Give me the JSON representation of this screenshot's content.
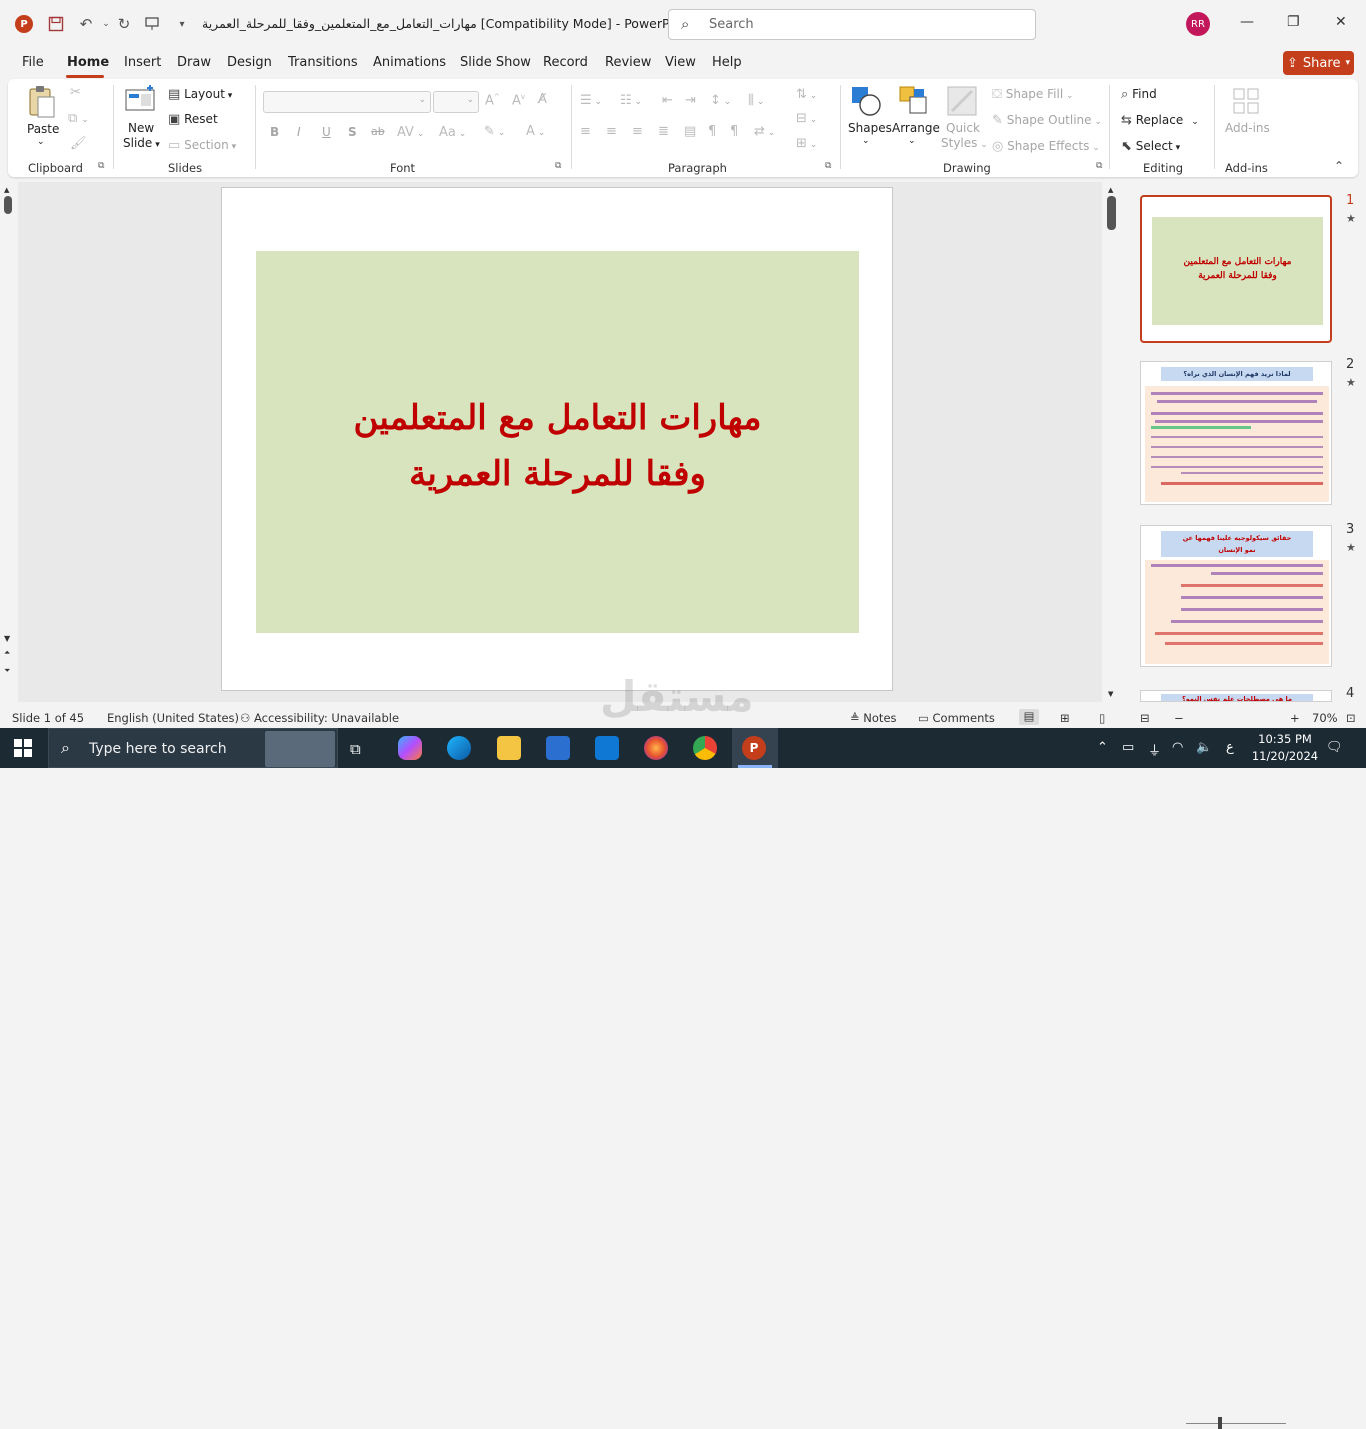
{
  "titlebar": {
    "doc_title": "مهارات_التعامل_مع_المتعلمين_وفقا_للمرحلة_العمرية [Compatibility Mode]  -  PowerP...",
    "search_placeholder": "Search",
    "avatar_initials": "RR"
  },
  "menu": {
    "tabs": [
      "File",
      "Home",
      "Insert",
      "Draw",
      "Design",
      "Transitions",
      "Animations",
      "Slide Show",
      "Record",
      "Review",
      "View",
      "Help"
    ],
    "share_label": "Share"
  },
  "ribbon": {
    "clipboard": {
      "paste": "Paste",
      "group": "Clipboard"
    },
    "slides": {
      "new_slide_line1": "New",
      "new_slide_line2": "Slide",
      "layout": "Layout",
      "reset": "Reset",
      "section": "Section",
      "group": "Slides"
    },
    "font": {
      "bold": "B",
      "italic": "I",
      "underline": "U",
      "shadow": "S",
      "strike": "ab",
      "group": "Font"
    },
    "paragraph": {
      "group": "Paragraph"
    },
    "drawing": {
      "shapes": "Shapes",
      "arrange": "Arrange",
      "quick_styles_1": "Quick",
      "quick_styles_2": "Styles",
      "shape_fill": "Shape Fill",
      "shape_outline": "Shape Outline",
      "shape_effects": "Shape Effects",
      "group": "Drawing"
    },
    "editing": {
      "find": "Find",
      "replace": "Replace",
      "select": "Select",
      "group": "Editing"
    },
    "addins": {
      "addins": "Add-ins",
      "group": "Add-ins"
    }
  },
  "slide": {
    "title_line1": "مهارات التعامل مع المتعلمين",
    "title_line2": "وفقا للمرحلة العمرية",
    "title_color": "#c00000",
    "box_color": "#d7e4bd"
  },
  "thumbnails": [
    {
      "num": "1",
      "line1": "مهارات التعامل مع المتعلمين",
      "line2": "وفقا للمرحلة العمرية"
    },
    {
      "num": "2",
      "heading": "لماذا نريد فهم الإنسان الذي نراه؟"
    },
    {
      "num": "3",
      "heading": "حقائق سيكولوجيه علينا فهمها عن نمو الإنسان"
    },
    {
      "num": "4",
      "heading": "ما هي مصطلحات علم نفس النمو؟"
    }
  ],
  "status": {
    "slide_count": "Slide 1 of 45",
    "language": "English (United States)",
    "accessibility": "Accessibility: Unavailable",
    "notes": "Notes",
    "comments": "Comments",
    "zoom": "70%"
  },
  "taskbar": {
    "search_placeholder": "Type here to search",
    "time": "10:35 PM",
    "date": "11/20/2024",
    "lang": "ع"
  },
  "watermark": "مستقل"
}
